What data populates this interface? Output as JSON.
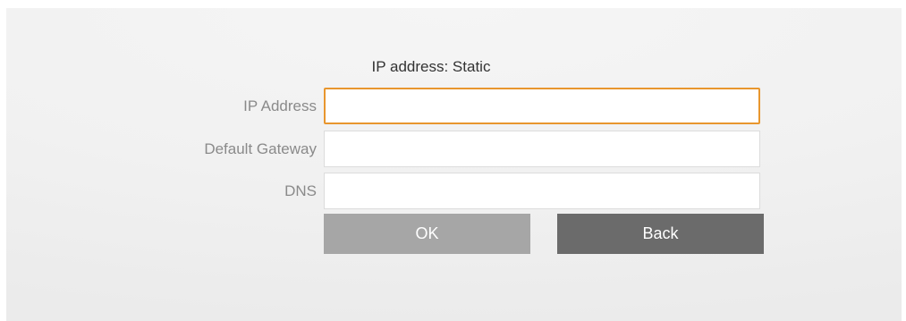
{
  "form": {
    "title": "IP address: Static",
    "fields": [
      {
        "label": "IP Address",
        "value": "",
        "placeholder": ""
      },
      {
        "label": "Default Gateway",
        "value": "",
        "placeholder": ""
      },
      {
        "label": "DNS",
        "value": "",
        "placeholder": ""
      }
    ],
    "ok_label": "OK",
    "back_label": "Back"
  },
  "colors": {
    "focus_border": "#e8962e",
    "ok_button": "#a6a6a6",
    "back_button": "#6b6b6b",
    "label_text": "#8a8a8a",
    "background": "#f1f1f1"
  }
}
